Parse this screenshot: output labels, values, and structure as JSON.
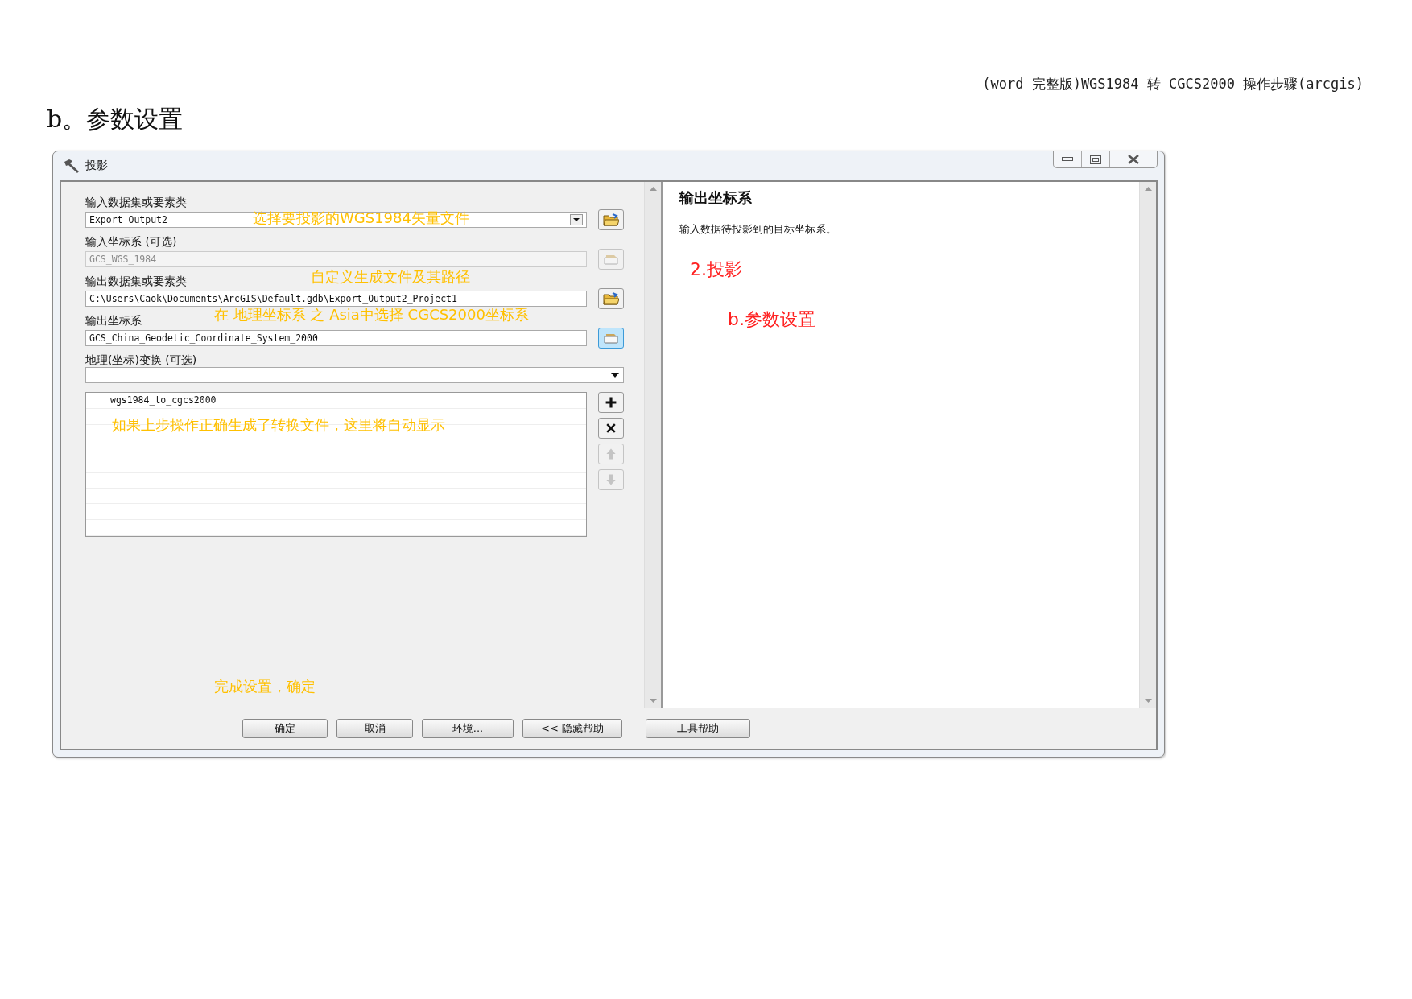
{
  "document": {
    "header": "(word 完整版)WGS1984 转 CGCS2000 操作步骤(arcgis)",
    "heading": "b。参数设置"
  },
  "window": {
    "title": "投影"
  },
  "fields": [
    {
      "label": "输入数据集或要素类",
      "kind": "dropdown",
      "value": "Export_Output2",
      "disabled": false,
      "button_highlighted": false,
      "annotation": "选择要投影的WGS1984矢量文件"
    },
    {
      "label": "输入坐标系 (可选)",
      "kind": "text",
      "value": "GCS_WGS_1984",
      "disabled": true,
      "button_highlighted": false
    },
    {
      "label": "输出数据集或要素类",
      "kind": "text",
      "value": "C:\\Users\\Caok\\Documents\\ArcGIS\\Default.gdb\\Export_Output2_Project1",
      "disabled": false,
      "button_highlighted": false,
      "annotation": "自定义生成文件及其路径"
    },
    {
      "label": "输出坐标系",
      "kind": "text",
      "value": "GCS_China_Geodetic_Coordinate_System_2000",
      "disabled": false,
      "button_highlighted": true,
      "annotation": "在 地理坐标系 之 Asia中选择 CGCS2000坐标系"
    }
  ],
  "transform": {
    "label": "地理(坐标)变换 (可选)",
    "items": [
      "wgs1984_to_cgcs2000"
    ],
    "annotation": "如果上步操作正确生成了转换文件，这里将自动显示",
    "list_buttons": [
      {
        "kind": "add",
        "disabled": false
      },
      {
        "kind": "remove",
        "disabled": false
      },
      {
        "kind": "up",
        "disabled": true
      },
      {
        "kind": "down",
        "disabled": true
      }
    ]
  },
  "bottom_annotation": "完成设置，确定",
  "buttons": [
    "确定",
    "取消",
    "环境...",
    "<< 隐藏帮助",
    "工具帮助"
  ],
  "help": {
    "title": "输出坐标系",
    "text": "输入数据待投影到的目标坐标系。",
    "annotations": [
      "2.投影",
      "b.参数设置"
    ]
  }
}
